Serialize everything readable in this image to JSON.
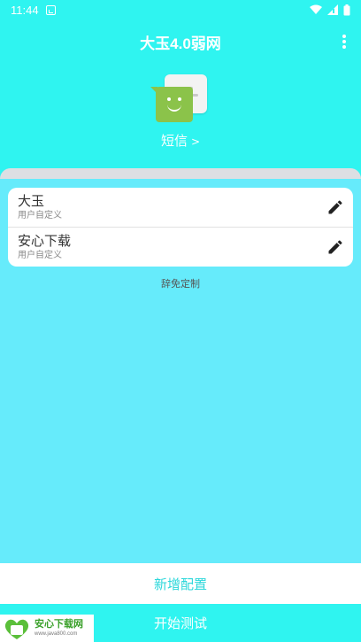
{
  "status": {
    "time": "11:44"
  },
  "app_bar": {
    "title": "大玉4.0弱网"
  },
  "app": {
    "label": "短信",
    "arrow": ">"
  },
  "configs": [
    {
      "title": "大玉",
      "subtitle": "用户自定义"
    },
    {
      "title": "安心下载",
      "subtitle": "用户自定义"
    }
  ],
  "exempt_label": "辞免定制",
  "buttons": {
    "add": "新增配置",
    "start": "开始测试"
  },
  "watermark": {
    "title": "安心下载网",
    "url": "www.java800.com",
    "logo_text": "安心\n下载"
  },
  "colors": {
    "primary": "#2ff4f0",
    "panel": "#66ebfb",
    "accent_text": "#2bd7da",
    "icon_green": "#8bc34a"
  }
}
